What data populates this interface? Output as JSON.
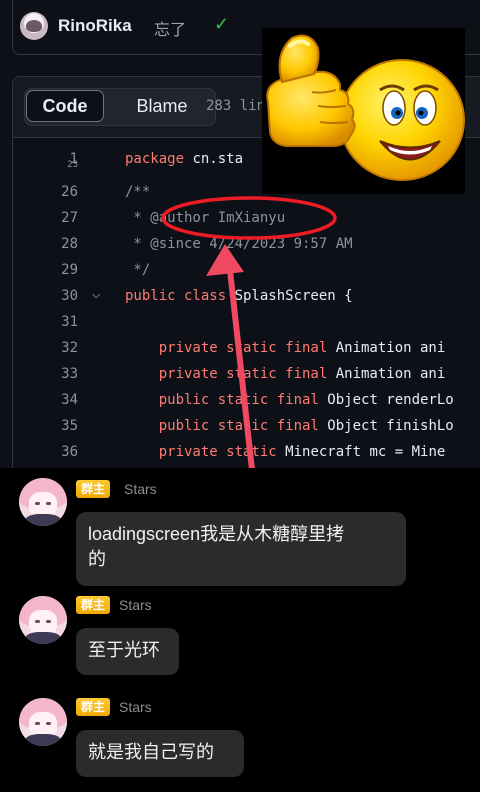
{
  "commit": {
    "username": "RinoRika",
    "message": "忘了",
    "status_icon": "check-icon"
  },
  "file_view": {
    "tabs": [
      {
        "label": "Code"
      },
      {
        "label": "Blame"
      }
    ],
    "lines_info": "283 lin"
  },
  "code_lines": [
    {
      "num": "1",
      "num_overlap": "23",
      "fold": false,
      "parts": [
        {
          "t": "kw",
          "v": "package "
        },
        {
          "t": "tp",
          "v": "cn.sta"
        }
      ]
    },
    {
      "num": "26",
      "fold": false,
      "parts": [
        {
          "t": "cm",
          "v": "/**"
        }
      ]
    },
    {
      "num": "27",
      "fold": false,
      "parts": [
        {
          "t": "cm",
          "v": " * @author ImXianyu"
        }
      ]
    },
    {
      "num": "28",
      "fold": false,
      "parts": [
        {
          "t": "cm",
          "v": " * @since 4/24/2023 9:57 AM"
        }
      ]
    },
    {
      "num": "29",
      "fold": false,
      "parts": [
        {
          "t": "cm",
          "v": " */"
        }
      ]
    },
    {
      "num": "30",
      "fold": true,
      "parts": [
        {
          "t": "kw",
          "v": "public class "
        },
        {
          "t": "tp",
          "v": "SplashScreen {"
        }
      ]
    },
    {
      "num": "31",
      "fold": false,
      "parts": []
    },
    {
      "num": "32",
      "fold": false,
      "parts": [
        {
          "t": "kw",
          "v": "    private static final "
        },
        {
          "t": "tp",
          "v": "Animation ani"
        }
      ]
    },
    {
      "num": "33",
      "fold": false,
      "parts": [
        {
          "t": "kw",
          "v": "    private static final "
        },
        {
          "t": "tp",
          "v": "Animation ani"
        }
      ]
    },
    {
      "num": "34",
      "fold": false,
      "parts": [
        {
          "t": "kw",
          "v": "    public static final "
        },
        {
          "t": "tp",
          "v": "Object renderLo"
        }
      ]
    },
    {
      "num": "35",
      "fold": false,
      "parts": [
        {
          "t": "kw",
          "v": "    public static final "
        },
        {
          "t": "tp",
          "v": "Object finishLo"
        }
      ]
    },
    {
      "num": "36",
      "fold": false,
      "parts": [
        {
          "t": "kw",
          "v": "    private static "
        },
        {
          "t": "tp",
          "v": "Minecraft mc = Mine"
        }
      ]
    }
  ],
  "chat": {
    "messages": [
      {
        "badge": "群主",
        "name": "Stars",
        "text": "loadingscreen我是从木糖醇里拷\n的"
      },
      {
        "badge": "群主",
        "name": "Stars",
        "text": "至于光环"
      },
      {
        "badge": "群主",
        "name": "Stars",
        "text": "就是我自己写的"
      }
    ]
  },
  "colors": {
    "github_bg": "#0d1117",
    "keyword": "#ff7b72",
    "comment": "#8b949e",
    "annotation_red": "#ee1c25",
    "arrow_red": "#f04a63",
    "badge_gold": "#f5b400",
    "bubble_bg": "#2b2b2b"
  }
}
